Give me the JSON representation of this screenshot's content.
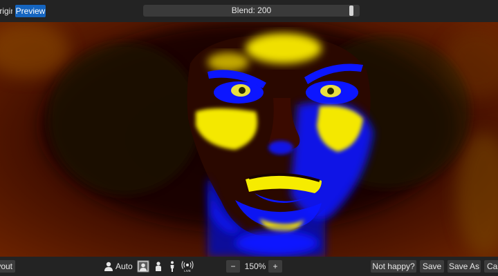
{
  "topbar": {
    "original_tab": "Original",
    "preview_tab": "Preview",
    "blend_label": "Blend: 200",
    "blend_level": 0.97
  },
  "bottombar": {
    "layout_button": "Layout",
    "auto_label": "Auto",
    "live_label": "LIVE",
    "zoom_minus": "−",
    "zoom_level": "150%",
    "zoom_plus": "+",
    "not_happy": "Not happy?",
    "save": "Save",
    "save_as": "Save As",
    "cancel": "Cancel"
  },
  "colors": {
    "accent": "#1565c0",
    "bar": "#232323",
    "button": "#3c3c3c"
  },
  "icons": [
    "person-auto-icon",
    "portrait-face-icon",
    "upper-body-icon",
    "full-body-icon",
    "live-broadcast-icon"
  ]
}
